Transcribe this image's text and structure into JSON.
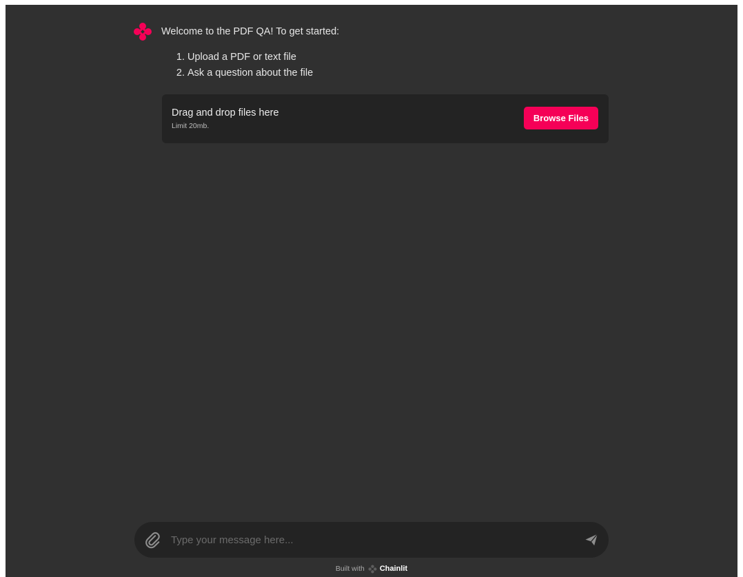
{
  "app": {
    "brand_color": "#f50057",
    "background_color": "#303030"
  },
  "message": {
    "avatar_icon": "chainlit-logo-icon",
    "text": "Welcome to the PDF QA! To get started:",
    "steps": [
      "Upload a PDF or text file",
      "Ask a question about the file"
    ]
  },
  "uploader": {
    "title": "Drag and drop files here",
    "limit": "Limit 20mb.",
    "browse_label": "Browse Files"
  },
  "composer": {
    "attach_icon": "paperclip-icon",
    "placeholder": "Type your message here...",
    "send_icon": "send-icon"
  },
  "footer": {
    "built_with": "Built with",
    "brand_name": "Chainlit",
    "brand_icon": "chainlit-logo-icon"
  }
}
